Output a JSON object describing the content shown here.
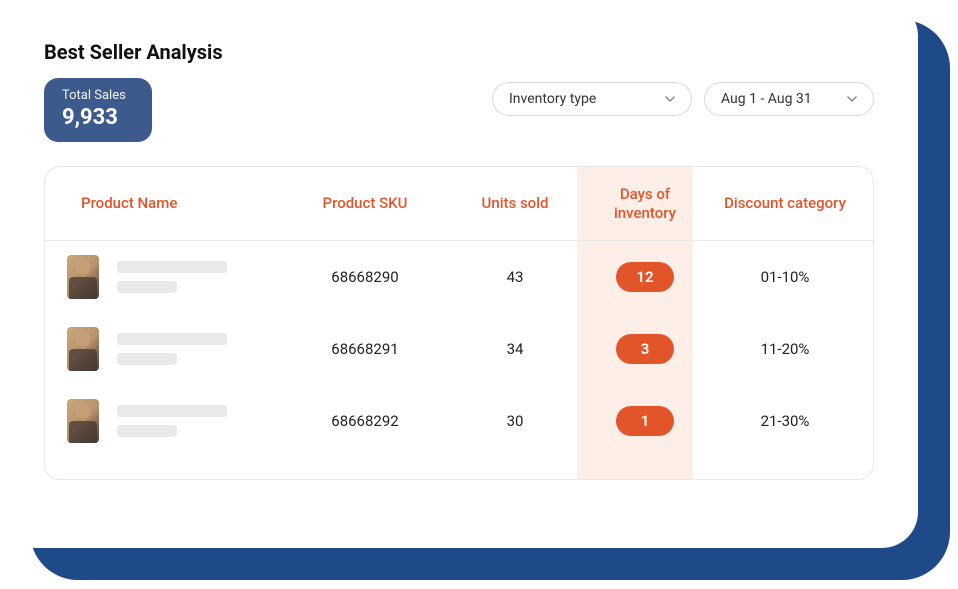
{
  "title": "Best Seller Analysis",
  "total_sales": {
    "label": "Total Sales",
    "value": "9,933"
  },
  "filters": {
    "inventory_type": {
      "label": "Inventory type"
    },
    "date_range": {
      "label": "Aug 1 - Aug 31"
    }
  },
  "table": {
    "headers": {
      "product_name": "Product Name",
      "product_sku": "Product SKU",
      "units_sold": "Units sold",
      "days_of_inventory": "Days of inventory",
      "discount_category": "Discount category"
    },
    "rows": [
      {
        "sku": "68668290",
        "units_sold": "43",
        "days_of_inventory": "12",
        "discount_category": "01-10%"
      },
      {
        "sku": "68668291",
        "units_sold": "34",
        "days_of_inventory": "3",
        "discount_category": "11-20%"
      },
      {
        "sku": "68668292",
        "units_sold": "30",
        "days_of_inventory": "1",
        "discount_category": "21-30%"
      }
    ]
  }
}
